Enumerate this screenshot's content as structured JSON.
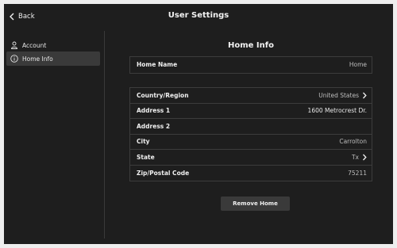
{
  "header": {
    "back_label": "Back",
    "title": "User Settings"
  },
  "sidebar": {
    "items": [
      {
        "label": "Account",
        "icon": "person-icon"
      },
      {
        "label": "Home Info",
        "icon": "info-icon",
        "active": true
      }
    ]
  },
  "main": {
    "section_title": "Home Info",
    "home_name": {
      "label": "Home Name",
      "value": "Home"
    },
    "address_rows": [
      {
        "label": "Country/Region",
        "value": "United States",
        "chevron": true
      },
      {
        "label": "Address 1",
        "value": "1600 Metrocrest Dr."
      },
      {
        "label": "Address 2",
        "value": ""
      },
      {
        "label": "City",
        "value": "Carrolton"
      },
      {
        "label": "State",
        "value": "Tx",
        "chevron": true
      },
      {
        "label": "Zip/Postal Code",
        "value": "75211"
      }
    ],
    "remove_button_label": "Remove Home"
  },
  "colors": {
    "background": "#1e1e1e",
    "active_item": "#3a3a3a",
    "border": "#3c3c3c"
  }
}
